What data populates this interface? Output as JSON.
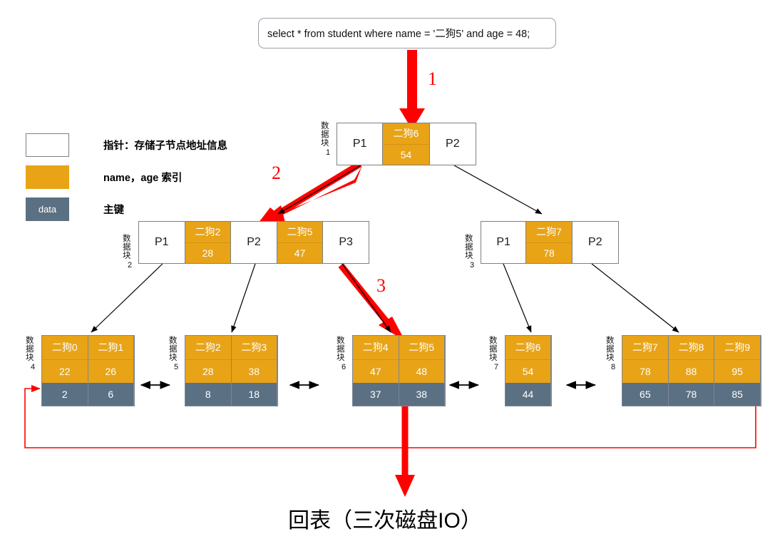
{
  "sql": {
    "query": "select * from student where name = '二狗5' and age = 48;"
  },
  "legend": {
    "items": [
      {
        "swatch": "white",
        "swatch_text": "",
        "label": "指针：存储子节点地址信息"
      },
      {
        "swatch": "orange",
        "swatch_text": "",
        "label": "name，age 索引"
      },
      {
        "swatch": "slate",
        "swatch_text": "data",
        "label": "主键"
      }
    ]
  },
  "colors": {
    "index_orange": "#E8A317",
    "data_slate": "#5B7082",
    "pointer_white": "#FFFFFF",
    "arrow_red": "#FF0000",
    "arrow_black": "#000000"
  },
  "steps": [
    {
      "id": "1",
      "label": "1"
    },
    {
      "id": "2",
      "label": "2"
    },
    {
      "id": "3",
      "label": "3"
    }
  ],
  "block_label_prefix": "数据块",
  "tree": {
    "root": {
      "block_label": "数据块",
      "block_number": "1",
      "cells": [
        {
          "type": "pointer",
          "text": "P1"
        },
        {
          "type": "key",
          "name": "二狗6",
          "age": "54"
        },
        {
          "type": "pointer",
          "text": "P2"
        }
      ]
    },
    "internal": [
      {
        "block_label": "数据块",
        "block_number": "2",
        "cells": [
          {
            "type": "pointer",
            "text": "P1"
          },
          {
            "type": "key",
            "name": "二狗2",
            "age": "28"
          },
          {
            "type": "pointer",
            "text": "P2"
          },
          {
            "type": "key",
            "name": "二狗5",
            "age": "47"
          },
          {
            "type": "pointer",
            "text": "P3"
          }
        ]
      },
      {
        "block_label": "数据块",
        "block_number": "3",
        "cells": [
          {
            "type": "pointer",
            "text": "P1"
          },
          {
            "type": "key",
            "name": "二狗7",
            "age": "78"
          },
          {
            "type": "pointer",
            "text": "P2"
          }
        ]
      }
    ],
    "leaves": [
      {
        "block_label": "数据块",
        "block_number": "4",
        "entries": [
          {
            "name": "二狗0",
            "age": "22",
            "data": "2"
          },
          {
            "name": "二狗1",
            "age": "26",
            "data": "6"
          }
        ]
      },
      {
        "block_label": "数据块",
        "block_number": "5",
        "entries": [
          {
            "name": "二狗2",
            "age": "28",
            "data": "8"
          },
          {
            "name": "二狗3",
            "age": "38",
            "data": "18"
          }
        ]
      },
      {
        "block_label": "数据块",
        "block_number": "6",
        "entries": [
          {
            "name": "二狗4",
            "age": "47",
            "data": "37"
          },
          {
            "name": "二狗5",
            "age": "48",
            "data": "38"
          }
        ]
      },
      {
        "block_label": "数据块",
        "block_number": "7",
        "entries": [
          {
            "name": "二狗6",
            "age": "54",
            "data": "44"
          }
        ]
      },
      {
        "block_label": "数据块",
        "block_number": "8",
        "entries": [
          {
            "name": "二狗7",
            "age": "78",
            "data": "65"
          },
          {
            "name": "二狗8",
            "age": "88",
            "data": "78"
          },
          {
            "name": "二狗9",
            "age": "95",
            "data": "85"
          }
        ]
      }
    ]
  },
  "caption": {
    "text": "回表（三次磁盘IO）"
  }
}
